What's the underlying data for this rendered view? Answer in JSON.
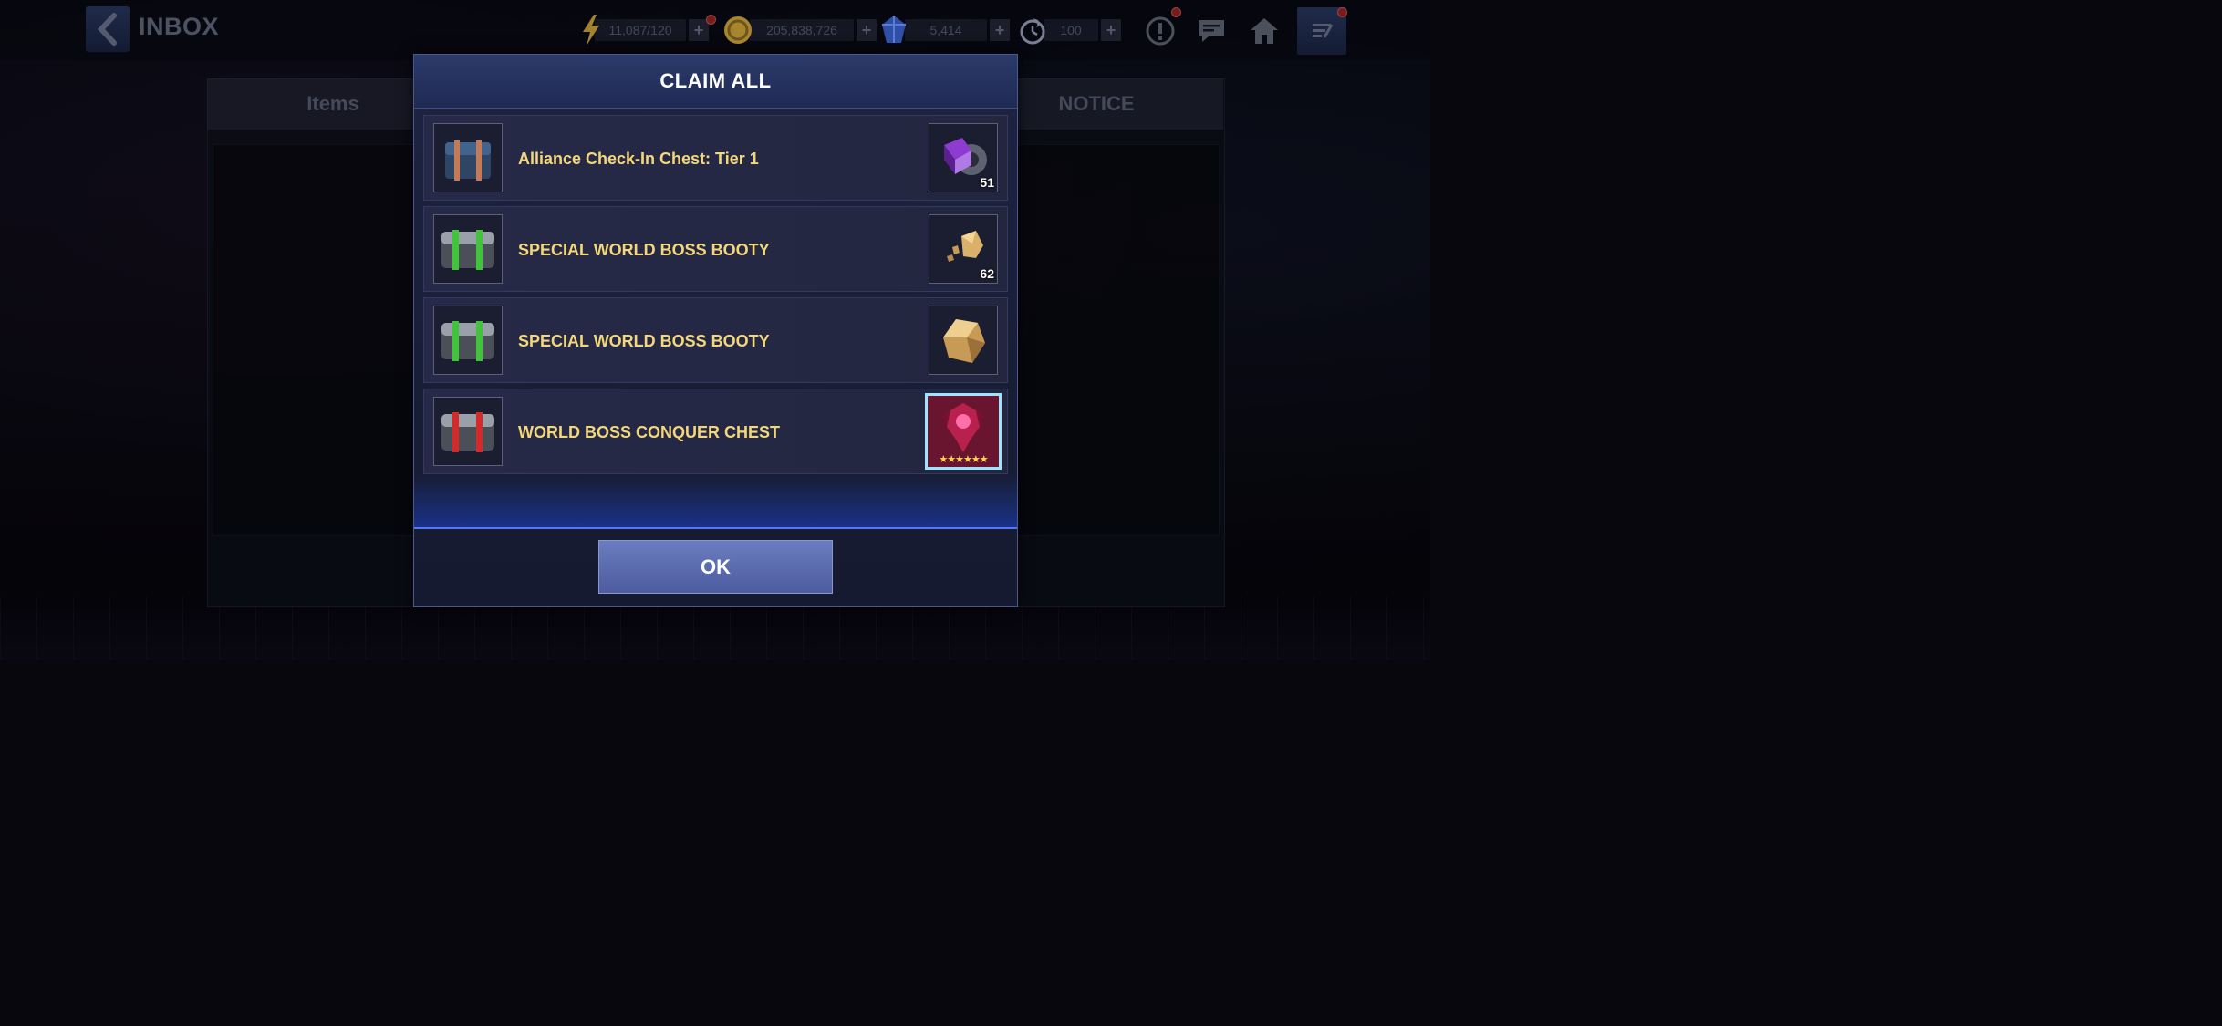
{
  "header": {
    "title": "INBOX",
    "resources": [
      {
        "icon": "lightning-icon",
        "value": "11,087/120"
      },
      {
        "icon": "gold-coin-icon",
        "value": "205,838,726"
      },
      {
        "icon": "blue-crystal-icon",
        "value": "5,414"
      },
      {
        "icon": "stamina-flame-icon",
        "value": "100"
      }
    ],
    "plus_label": "+"
  },
  "tabs": {
    "items": "Items",
    "notice": "NOTICE"
  },
  "modal": {
    "title": "CLAIM ALL",
    "rows": [
      {
        "label": "Alliance Check-In Chest: Tier 1",
        "chest_icon": "alliance-chest-icon",
        "reward_icon": "purple-gear-cube-icon",
        "qty": "51"
      },
      {
        "label": "SPECIAL WORLD BOSS BOOTY",
        "chest_icon": "green-chest-icon",
        "reward_icon": "gold-ore-fragments-icon",
        "qty": "62"
      },
      {
        "label": "SPECIAL WORLD BOSS BOOTY",
        "chest_icon": "green-chest-icon",
        "reward_icon": "gold-ore-icon",
        "qty": ""
      },
      {
        "label": "WORLD BOSS CONQUER CHEST",
        "chest_icon": "red-chest-icon",
        "reward_icon": "six-star-emblem-icon",
        "qty": ""
      }
    ],
    "ok_label": "OK",
    "rarity_stars": "★★★★★★"
  },
  "colors": {
    "item_label": "#f3d77a",
    "ok_button": "#5a6aae",
    "highlight_border": "#9fe4ff"
  }
}
